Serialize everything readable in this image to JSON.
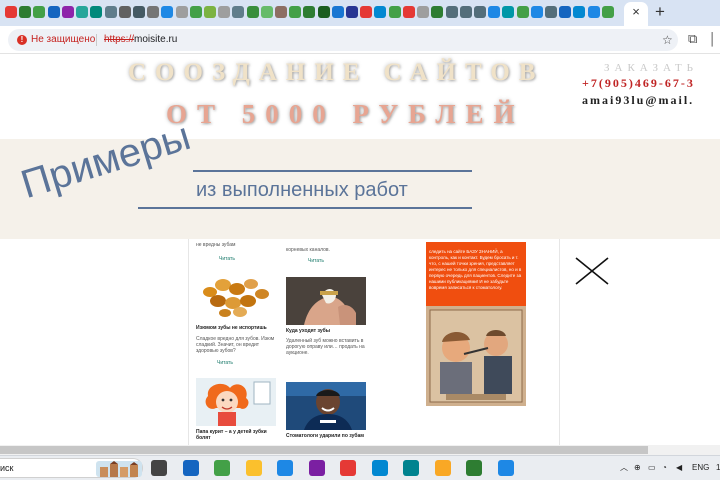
{
  "browser": {
    "tab_favicon_colors": [
      "#e53935",
      "#2e7d32",
      "#43a047",
      "#1565c0",
      "#8e24aa",
      "#26a69a",
      "#00897b",
      "#607d8b",
      "#616161",
      "#455a64",
      "#757575",
      "#1e88e5",
      "#9e9e9e",
      "#43a047",
      "#7cb342",
      "#9e9e9e",
      "#607d8b",
      "#388e3c",
      "#66bb6a",
      "#8d6e63",
      "#43a047",
      "#2e7d32",
      "#1b5e20",
      "#1976d2",
      "#283593",
      "#e53935",
      "#0288d1",
      "#43a047",
      "#e53935",
      "#9e9e9e",
      "#2e7d32",
      "#546e7a",
      "#546e7a",
      "#546e7a",
      "#1e88e5",
      "#0097a7",
      "#43a047",
      "#1e88e5",
      "#546e7a",
      "#1565c0",
      "#0288d1",
      "#1e88e5",
      "#43a047"
    ],
    "active_tab_close": "×",
    "new_tab": "+",
    "security_label": "Не защищено",
    "url_protocol": "https://",
    "url_host": "moisite.ru"
  },
  "header": {
    "headline_1": "СООЗДАНИЕ САЙТОВ",
    "headline_2": "ОТ 5000 РУБЛЕЙ",
    "order_label": "ЗАКАЗАТЬ",
    "phone": "+7(905)469-67-3",
    "email": "amai93lu@mail."
  },
  "banner": {
    "title": "Примеры",
    "subtitle": "из выполненных работ"
  },
  "content": {
    "left_top_text": "не вредны зубам",
    "left_top_read": "Читать",
    "right_top_text": "корневых каналов.",
    "right_top_read": "Читать",
    "card1": {
      "title": "Изюмом зубы не испортишь",
      "excerpt": "Сладкое вредно для зубов. Изюм сладкий. Значит, он вредит здоровью зубов?",
      "read": "Читать"
    },
    "card2": {
      "title": "Куда уходят зубы",
      "excerpt": "Удаленный зуб можно вставить в дорогую оправу или… продать на аукционе.",
      "read": "Читать"
    },
    "card3": {
      "title": "Папа курит – а у детей зубки болят"
    },
    "card4": {
      "title": "Стоматологи ударили по зубам"
    },
    "ad_text": "следить на сайте БАЗУ ЗНАНИЙ, а контроль, как и контакт. Будем бросать и т. что, с нашей точки зрения, представляет интерес не только для специалистов, но и в первую очередь для пациентов. Следите за нашими публикациями! И не забудьте вовремя записаться к стоматологу."
  },
  "taskbar": {
    "search_label": "иск",
    "app_icon_colors": [
      "#444444",
      "#1565c0",
      "#43a047",
      "#fbc02d",
      "#1e88e5",
      "#7b1fa2",
      "#e53935",
      "#0288d1",
      "#00838f",
      "#f9a825",
      "#2e7d32",
      "#1e88e5"
    ],
    "language": "ENG",
    "clock_fragment": "1"
  }
}
